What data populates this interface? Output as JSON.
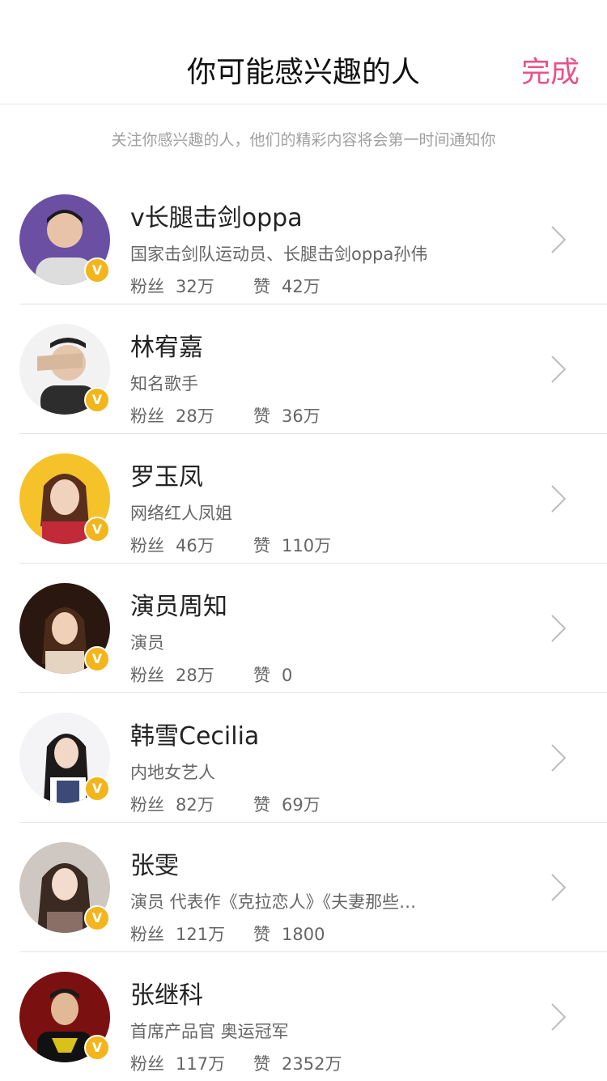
{
  "header": {
    "title": "你可能感兴趣的人",
    "done_label": "完成"
  },
  "subtitle": "关注你感兴趣的人，他们的精彩内容将会第一时间通知你",
  "labels": {
    "fans": "粉丝",
    "likes": "赞"
  },
  "colors": {
    "accent": "#e8528a",
    "verified_badge": "#f2b51b"
  },
  "users": [
    {
      "name": "v长腿击剑oppa",
      "desc": "国家击剑队运动员、长腿击剑oppa孙伟",
      "fans": "32万",
      "likes": "42万"
    },
    {
      "name": "林宥嘉",
      "desc": "知名歌手",
      "fans": "28万",
      "likes": "36万"
    },
    {
      "name": "罗玉凤",
      "desc": "网络红人凤姐",
      "fans": "46万",
      "likes": "110万"
    },
    {
      "name": "演员周知",
      "desc": "演员",
      "fans": "28万",
      "likes": "0"
    },
    {
      "name": "韩雪Cecilia",
      "desc": "内地女艺人",
      "fans": "82万",
      "likes": "69万"
    },
    {
      "name": "张雯",
      "desc": "演员 代表作《克拉恋人》《夫妻那些…",
      "fans": "121万",
      "likes": "1800"
    },
    {
      "name": "张继科",
      "desc": "首席产品官 奥运冠军",
      "fans": "117万",
      "likes": "2352万"
    }
  ]
}
